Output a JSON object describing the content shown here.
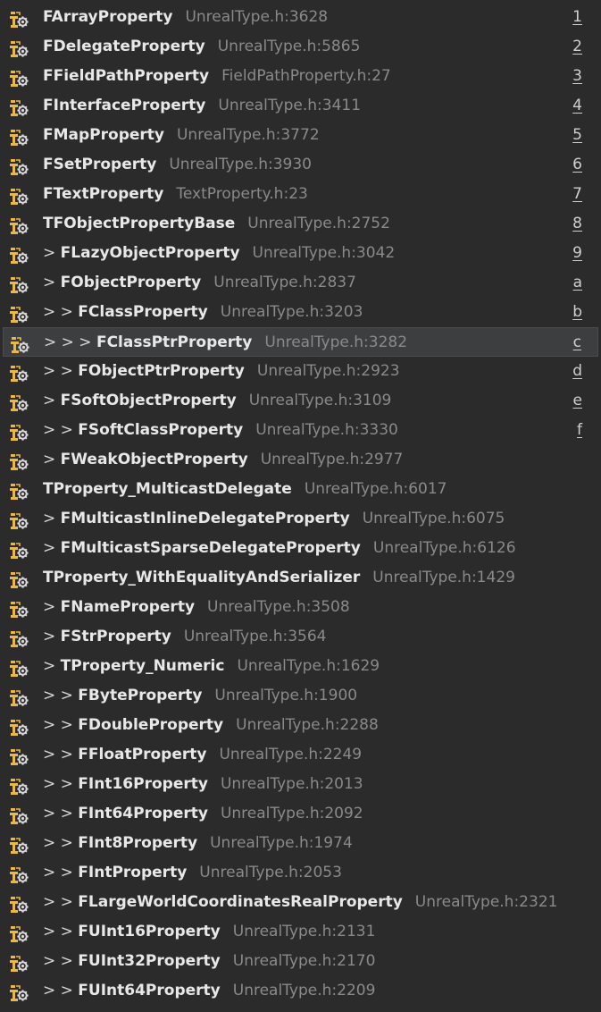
{
  "items": [
    {
      "prefix": "",
      "name": "FArrayProperty",
      "location": "UnrealType.h:3628",
      "shortcut": "1"
    },
    {
      "prefix": "",
      "name": "FDelegateProperty",
      "location": "UnrealType.h:5865",
      "shortcut": "2"
    },
    {
      "prefix": "",
      "name": "FFieldPathProperty",
      "location": "FieldPathProperty.h:27",
      "shortcut": "3"
    },
    {
      "prefix": "",
      "name": "FInterfaceProperty",
      "location": "UnrealType.h:3411",
      "shortcut": "4"
    },
    {
      "prefix": "",
      "name": "FMapProperty",
      "location": "UnrealType.h:3772",
      "shortcut": "5"
    },
    {
      "prefix": "",
      "name": "FSetProperty",
      "location": "UnrealType.h:3930",
      "shortcut": "6"
    },
    {
      "prefix": "",
      "name": "FTextProperty",
      "location": "TextProperty.h:23",
      "shortcut": "7"
    },
    {
      "prefix": "",
      "name": "TFObjectPropertyBase",
      "location": "UnrealType.h:2752",
      "shortcut": "8"
    },
    {
      "prefix": "> ",
      "name": "FLazyObjectProperty",
      "location": "UnrealType.h:3042",
      "shortcut": "9"
    },
    {
      "prefix": "> ",
      "name": "FObjectProperty",
      "location": "UnrealType.h:2837",
      "shortcut": "a"
    },
    {
      "prefix": "> > ",
      "name": "FClassProperty",
      "location": "UnrealType.h:3203",
      "shortcut": "b"
    },
    {
      "prefix": "> > > ",
      "name": "FClassPtrProperty",
      "location": "UnrealType.h:3282",
      "shortcut": "c",
      "selected": true
    },
    {
      "prefix": "> > ",
      "name": "FObjectPtrProperty",
      "location": "UnrealType.h:2923",
      "shortcut": "d"
    },
    {
      "prefix": "> ",
      "name": "FSoftObjectProperty",
      "location": "UnrealType.h:3109",
      "shortcut": "e"
    },
    {
      "prefix": "> > ",
      "name": "FSoftClassProperty",
      "location": "UnrealType.h:3330",
      "shortcut": "f"
    },
    {
      "prefix": "> ",
      "name": "FWeakObjectProperty",
      "location": "UnrealType.h:2977",
      "shortcut": ""
    },
    {
      "prefix": "",
      "name": "TProperty_MulticastDelegate",
      "location": "UnrealType.h:6017",
      "shortcut": ""
    },
    {
      "prefix": "> ",
      "name": "FMulticastInlineDelegateProperty",
      "location": "UnrealType.h:6075",
      "shortcut": ""
    },
    {
      "prefix": "> ",
      "name": "FMulticastSparseDelegateProperty",
      "location": "UnrealType.h:6126",
      "shortcut": ""
    },
    {
      "prefix": "",
      "name": "TProperty_WithEqualityAndSerializer",
      "location": "UnrealType.h:1429",
      "shortcut": ""
    },
    {
      "prefix": "> ",
      "name": "FNameProperty",
      "location": "UnrealType.h:3508",
      "shortcut": ""
    },
    {
      "prefix": "> ",
      "name": "FStrProperty",
      "location": "UnrealType.h:3564",
      "shortcut": ""
    },
    {
      "prefix": "> ",
      "name": "TProperty_Numeric",
      "location": "UnrealType.h:1629",
      "shortcut": ""
    },
    {
      "prefix": "> > ",
      "name": "FByteProperty",
      "location": "UnrealType.h:1900",
      "shortcut": ""
    },
    {
      "prefix": "> > ",
      "name": "FDoubleProperty",
      "location": "UnrealType.h:2288",
      "shortcut": ""
    },
    {
      "prefix": "> > ",
      "name": "FFloatProperty",
      "location": "UnrealType.h:2249",
      "shortcut": ""
    },
    {
      "prefix": "> > ",
      "name": "FInt16Property",
      "location": "UnrealType.h:2013",
      "shortcut": ""
    },
    {
      "prefix": "> > ",
      "name": "FInt64Property",
      "location": "UnrealType.h:2092",
      "shortcut": ""
    },
    {
      "prefix": "> > ",
      "name": "FInt8Property",
      "location": "UnrealType.h:1974",
      "shortcut": ""
    },
    {
      "prefix": "> > ",
      "name": "FIntProperty",
      "location": "UnrealType.h:2053",
      "shortcut": ""
    },
    {
      "prefix": "> > ",
      "name": "FLargeWorldCoordinatesRealProperty",
      "location": "UnrealType.h:2321",
      "shortcut": ""
    },
    {
      "prefix": "> > ",
      "name": "FUInt16Property",
      "location": "UnrealType.h:2131",
      "shortcut": ""
    },
    {
      "prefix": "> > ",
      "name": "FUInt32Property",
      "location": "UnrealType.h:2170",
      "shortcut": ""
    },
    {
      "prefix": "> > ",
      "name": "FUInt64Property",
      "location": "UnrealType.h:2209",
      "shortcut": ""
    }
  ],
  "icon": "class-hierarchy-icon",
  "colors": {
    "background": "#2b2b2b",
    "selected_background": "#3c3e40",
    "name_text": "#e8e8e8",
    "location_text": "#8a8a8a",
    "icon_yellow": "#e8b84a"
  }
}
